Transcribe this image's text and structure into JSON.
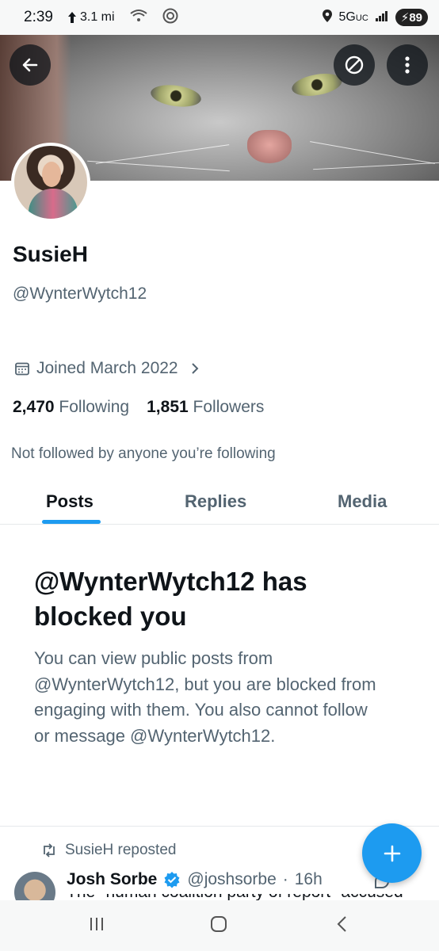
{
  "status_bar": {
    "time": "2:39",
    "distance": "3.1 mi",
    "network": "5G",
    "network_sub": "UC",
    "battery": "89"
  },
  "banner": {
    "back_icon": "arrow-left-icon",
    "hide_icon": "circle-slash-icon",
    "more_icon": "more-vertical-icon"
  },
  "profile": {
    "name": "SusieH",
    "handle": "@WynterWytch12",
    "joined": "Joined March 2022",
    "following_count": "2,470",
    "following_label": "Following",
    "followers_count": "1,851",
    "followers_label": "Followers",
    "not_followed": "Not followed by anyone you’re following"
  },
  "tabs": [
    {
      "label": "Posts",
      "active": true
    },
    {
      "label": "Replies",
      "active": false
    },
    {
      "label": "Media",
      "active": false
    }
  ],
  "blocked": {
    "title": "@WynterWytch12 has blocked you",
    "body": "You can view public posts from @WynterWytch12, but you are blocked from engaging with them. You also cannot follow or message @WynterWytch12."
  },
  "post": {
    "repost_label": "SusieH reposted",
    "author_name": "Josh Sorbe",
    "author_handle": "@joshsorbe",
    "time": "16h",
    "text_peek": "The \"human coalition party of report\" accused"
  },
  "colors": {
    "accent": "#1d9bf0",
    "secondary_text": "#536471",
    "primary_text": "#0f1419"
  }
}
